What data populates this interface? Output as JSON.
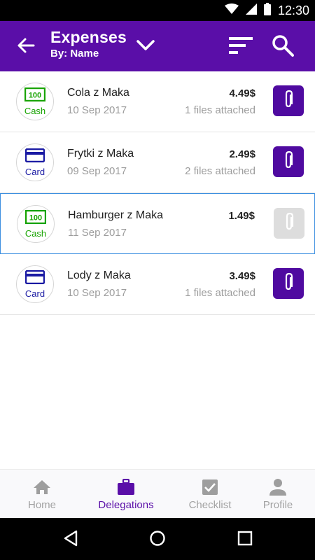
{
  "status_bar": {
    "time": "12:30"
  },
  "header": {
    "title": "Expenses",
    "subtitle": "By: Name"
  },
  "expenses": [
    {
      "name": "Cola z Maka",
      "date": "10 Sep 2017",
      "amount": "4.49$",
      "files": "1 files attached",
      "method": "Cash",
      "selected": false,
      "attachments_enabled": true
    },
    {
      "name": "Frytki z Maka",
      "date": "09 Sep 2017",
      "amount": "2.49$",
      "files": "2 files attached",
      "method": "Card",
      "selected": false,
      "attachments_enabled": true
    },
    {
      "name": "Hamburger z Maka",
      "date": "11 Sep 2017",
      "amount": "1.49$",
      "files": "",
      "method": "Cash",
      "selected": true,
      "attachments_enabled": false
    },
    {
      "name": "Lody z Maka",
      "date": "10 Sep 2017",
      "amount": "3.49$",
      "files": "1 files attached",
      "method": "Card",
      "selected": false,
      "attachments_enabled": true
    }
  ],
  "bottom_nav": {
    "home": "Home",
    "delegations": "Delegations",
    "checklist": "Checklist",
    "profile": "Profile",
    "active": "Delegations"
  },
  "colors": {
    "primary": "#5a0ea8",
    "attach_button": "#4f0aa0",
    "attach_button_disabled": "#dddddd",
    "cash": "#17a300",
    "card": "#1a1aa3",
    "selected_border": "#3b8fe0"
  },
  "icons": {
    "status": [
      "wifi-icon",
      "signal-icon",
      "battery-icon"
    ],
    "header": [
      "back-arrow-icon",
      "chevron-down-icon",
      "sort-icon",
      "search-icon"
    ],
    "cash": "cash-icon",
    "card": "credit-card-icon",
    "attach": "paperclip-icon",
    "nav": [
      "home-icon",
      "briefcase-icon",
      "checkbox-icon",
      "person-icon"
    ],
    "system": [
      "back-triangle-icon",
      "home-circle-icon",
      "recents-square-icon"
    ]
  }
}
